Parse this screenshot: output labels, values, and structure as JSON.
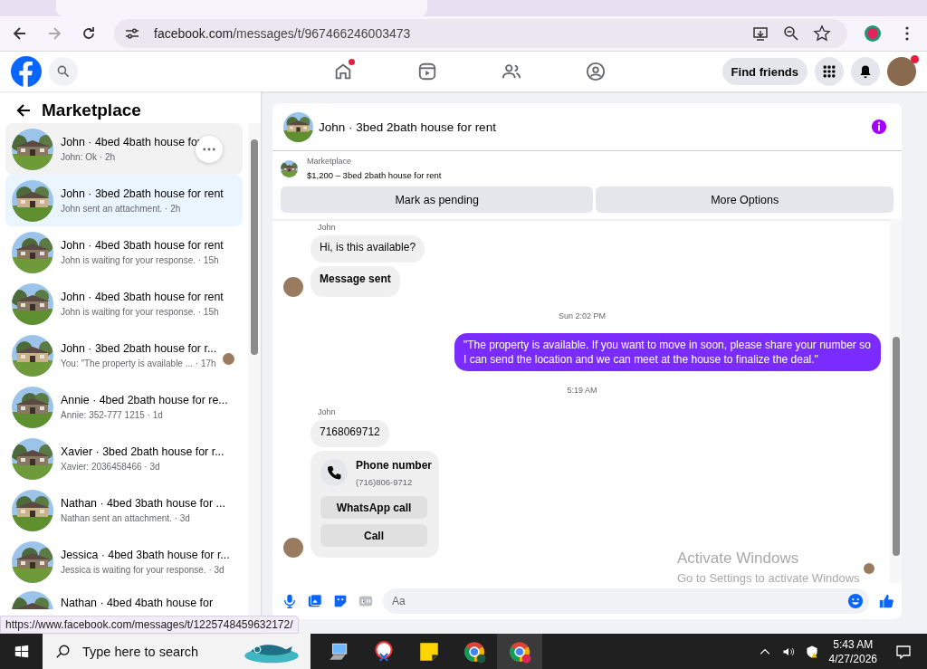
{
  "browser": {
    "url_domain": "facebook.com",
    "url_path": "/messages/t/967466246003473"
  },
  "nav_tabs": [
    {
      "kind": "home",
      "dot": true
    },
    {
      "kind": "reels",
      "dot": false
    },
    {
      "kind": "friends",
      "dot": false
    },
    {
      "kind": "groups",
      "dot": false
    }
  ],
  "header": {
    "find_friends": "Find friends",
    "profile_dot": true
  },
  "sidebar": {
    "title": "Marketplace",
    "conversations": [
      {
        "title": "John · 4bed 4bath house for",
        "preview": "John: Ok · 2h",
        "selected": false,
        "hovered": true,
        "seen": false
      },
      {
        "title": "John · 3bed 2bath house for rent",
        "preview": "John sent an attachment. · 2h",
        "selected": true,
        "hovered": false,
        "seen": false
      },
      {
        "title": "John · 4bed 3bath house for rent",
        "preview": "John is waiting for your response. · 15h",
        "selected": false,
        "hovered": false,
        "seen": false
      },
      {
        "title": "John · 4bed 3bath house for rent",
        "preview": "John is waiting for your response. · 15h",
        "selected": false,
        "hovered": false,
        "seen": false
      },
      {
        "title": "John · 3bed 2bath house for r...",
        "preview": "You: \"The property is available ... · 17h",
        "selected": false,
        "hovered": false,
        "seen": true
      },
      {
        "title": "Annie · 4bed 2bath house for re...",
        "preview": "Annie: 352-777 1215 · 1d",
        "selected": false,
        "hovered": false,
        "seen": false
      },
      {
        "title": "Xavier · 3bed 2bath house for r...",
        "preview": "Xavier: 2036458466 · 3d",
        "selected": false,
        "hovered": false,
        "seen": false
      },
      {
        "title": "Nathan · 4bed 3bath house for ...",
        "preview": "Nathan sent an attachment. · 3d",
        "selected": false,
        "hovered": false,
        "seen": false
      },
      {
        "title": "Jessica · 4bed 3bath house for r...",
        "preview": "Jessica is waiting for your response. · 3d",
        "selected": false,
        "hovered": false,
        "seen": false
      },
      {
        "title": "Nathan · 4bed 4bath house for",
        "selected": false,
        "hovered": false,
        "seen": false
      }
    ]
  },
  "chat": {
    "title": "John · 3bed 2bath house for rent",
    "listing_label": "Marketplace",
    "listing": "$1,200 – 3bed 2bath house for rent",
    "actions": [
      "Mark as pending",
      "More Options"
    ],
    "messages": [
      {
        "kind": "sender",
        "text": "John"
      },
      {
        "kind": "incoming",
        "text": "Hi, is this available?",
        "avatar": false,
        "bold": false
      },
      {
        "kind": "incoming",
        "text": "Message sent",
        "avatar": true,
        "bold": true
      },
      {
        "kind": "timestamp",
        "text": "Sun 2:02 PM"
      },
      {
        "kind": "outgoing",
        "text": "\"The property is available. If you want to move in soon, please share your number so I can send the location and we can meet at the house to finalize the deal.\""
      },
      {
        "kind": "timestamp",
        "text": "5:19 AM"
      },
      {
        "kind": "sender",
        "text": "John"
      },
      {
        "kind": "incoming",
        "text": "7168069712",
        "avatar": false,
        "bold": false
      },
      {
        "kind": "contact",
        "title": "Phone number",
        "number": "(716)806-9712",
        "buttons": [
          "WhatsApp call",
          "Call"
        ],
        "avatar": true
      }
    ],
    "composer": {
      "placeholder": "Aa"
    }
  },
  "os_notice": {
    "title": "Activate Windows",
    "text": "Go to Settings to activate Windows"
  },
  "status_url": "https://www.facebook.com/messages/t/1225748459632172/",
  "taskbar": {
    "search_placeholder": "Type here to search",
    "time": "5:43 AM",
    "date": "4/27/2026"
  }
}
